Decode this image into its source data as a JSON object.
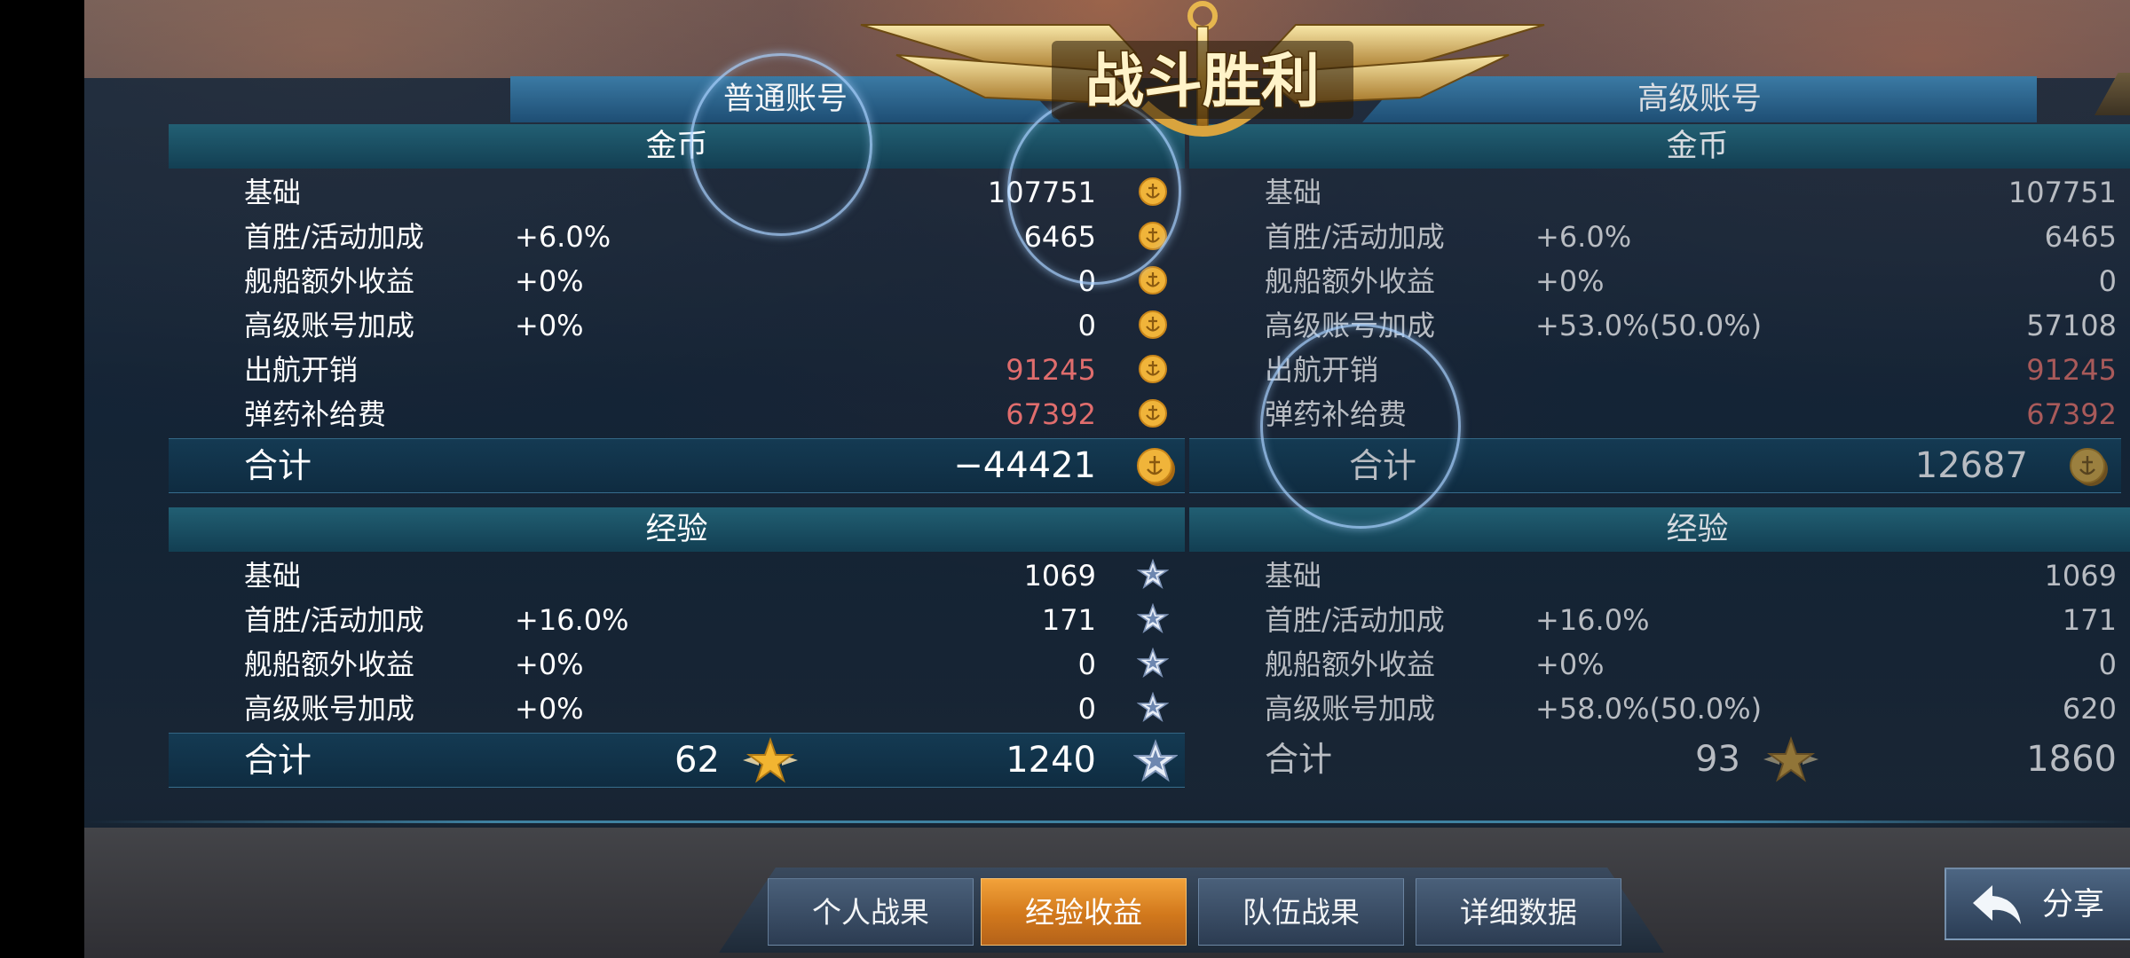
{
  "title": "战斗胜利",
  "close_label": "✕",
  "accounts": {
    "normal": "普通账号",
    "premium": "高级账号"
  },
  "normal": {
    "coins": {
      "header": "金币",
      "rows": [
        {
          "label": "基础",
          "pct": "",
          "value": "107751",
          "negative": false
        },
        {
          "label": "首胜/活动加成",
          "pct": "+6.0%",
          "value": "6465",
          "negative": false
        },
        {
          "label": "舰船额外收益",
          "pct": "+0%",
          "value": "0",
          "negative": false
        },
        {
          "label": "高级账号加成",
          "pct": "+0%",
          "value": "0",
          "negative": false
        },
        {
          "label": "出航开销",
          "pct": "",
          "value": "91245",
          "negative": true
        },
        {
          "label": "弹药补给费",
          "pct": "",
          "value": "67392",
          "negative": true
        }
      ],
      "total_label": "合计",
      "total_value": "−44421"
    },
    "exp": {
      "header": "经验",
      "rows": [
        {
          "label": "基础",
          "pct": "",
          "value": "1069"
        },
        {
          "label": "首胜/活动加成",
          "pct": "+16.0%",
          "value": "171"
        },
        {
          "label": "舰船额外收益",
          "pct": "+0%",
          "value": "0"
        },
        {
          "label": "高级账号加成",
          "pct": "+0%",
          "value": "0"
        }
      ],
      "total_label": "合计",
      "captain_value": "62",
      "total_value": "1240"
    }
  },
  "premium": {
    "coins": {
      "header": "金币",
      "rows": [
        {
          "label": "基础",
          "pct": "",
          "value": "107751",
          "negative": false
        },
        {
          "label": "首胜/活动加成",
          "pct": "+6.0%",
          "value": "6465",
          "negative": false
        },
        {
          "label": "舰船额外收益",
          "pct": "+0%",
          "value": "0",
          "negative": false
        },
        {
          "label": "高级账号加成",
          "pct": "+53.0%(50.0%)",
          "value": "57108",
          "negative": false
        },
        {
          "label": "出航开销",
          "pct": "",
          "value": "91245",
          "negative": true
        },
        {
          "label": "弹药补给费",
          "pct": "",
          "value": "67392",
          "negative": true
        }
      ],
      "total_label": "合计",
      "total_value": "12687"
    },
    "exp": {
      "header": "经验",
      "rows": [
        {
          "label": "基础",
          "pct": "",
          "value": "1069"
        },
        {
          "label": "首胜/活动加成",
          "pct": "+16.0%",
          "value": "171"
        },
        {
          "label": "舰船额外收益",
          "pct": "+0%",
          "value": "0"
        },
        {
          "label": "高级账号加成",
          "pct": "+58.0%(50.0%)",
          "value": "620"
        }
      ],
      "total_label": "合计",
      "captain_value": "93",
      "total_value": "1860"
    }
  },
  "nav": {
    "items": [
      {
        "label": "个人战果",
        "active": false
      },
      {
        "label": "经验收益",
        "active": true
      },
      {
        "label": "队伍战果",
        "active": false
      },
      {
        "label": "详细数据",
        "active": false
      }
    ],
    "share_label": "分享"
  },
  "colors": {
    "negative": "#e06d6d",
    "accent_active": "#e88a2a",
    "gold": "#f0b43a",
    "silver_star": "#c9d6ea"
  },
  "icons": {
    "coin": "coin-icon",
    "exp_star": "exp-star-icon",
    "captain_star": "captain-star-icon",
    "share": "share-arrow-icon",
    "close": "close-icon"
  }
}
